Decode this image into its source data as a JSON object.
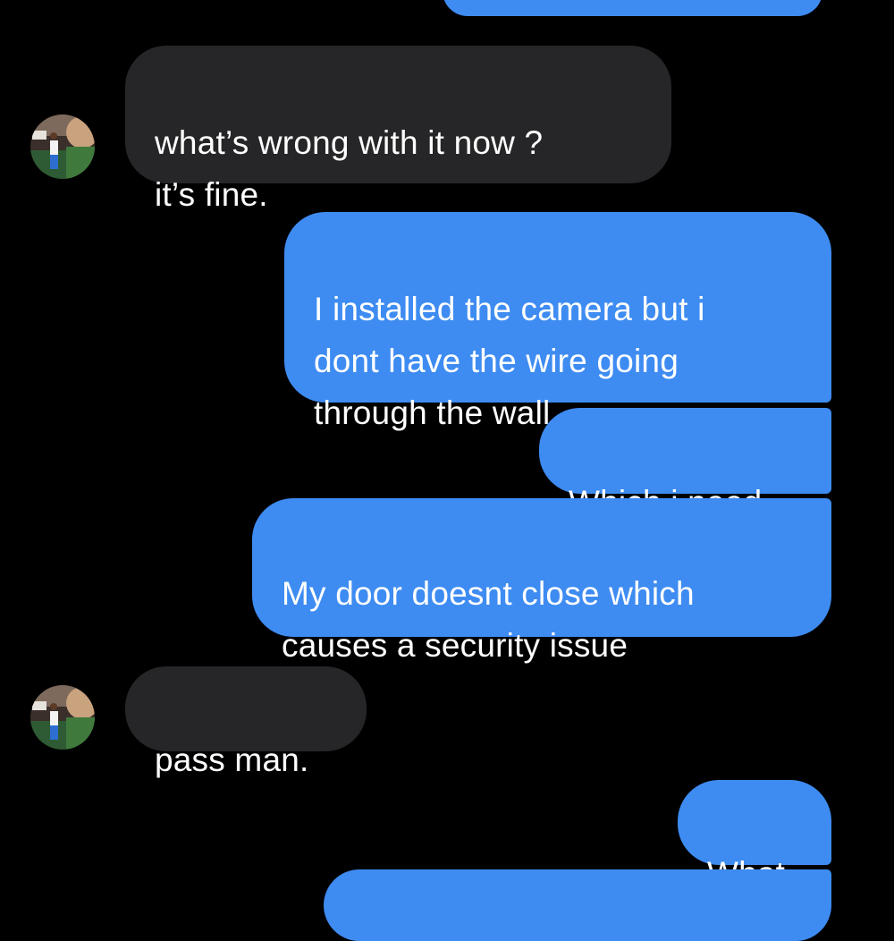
{
  "colors": {
    "background": "#000000",
    "incoming_bubble": "#262628",
    "outgoing_bubble": "#3e8cf2",
    "text": "#ffffff"
  },
  "messages": [
    {
      "id": "m0",
      "direction": "outgoing",
      "text": ""
    },
    {
      "id": "m1",
      "direction": "incoming",
      "text": "what’s wrong with it now ?\nit’s fine."
    },
    {
      "id": "m2",
      "direction": "outgoing",
      "text": "I installed the camera but i\ndont have the wire going\nthrough the wall"
    },
    {
      "id": "m3",
      "direction": "outgoing",
      "text": "Which i need"
    },
    {
      "id": "m4",
      "direction": "outgoing",
      "text": "My door doesnt close which\ncauses a security issue"
    },
    {
      "id": "m5",
      "direction": "incoming",
      "text": "pass man."
    },
    {
      "id": "m6",
      "direction": "outgoing",
      "text": "What"
    },
    {
      "id": "m7",
      "direction": "outgoing",
      "text": ""
    }
  ],
  "avatar_icon": "contact-avatar-photo"
}
